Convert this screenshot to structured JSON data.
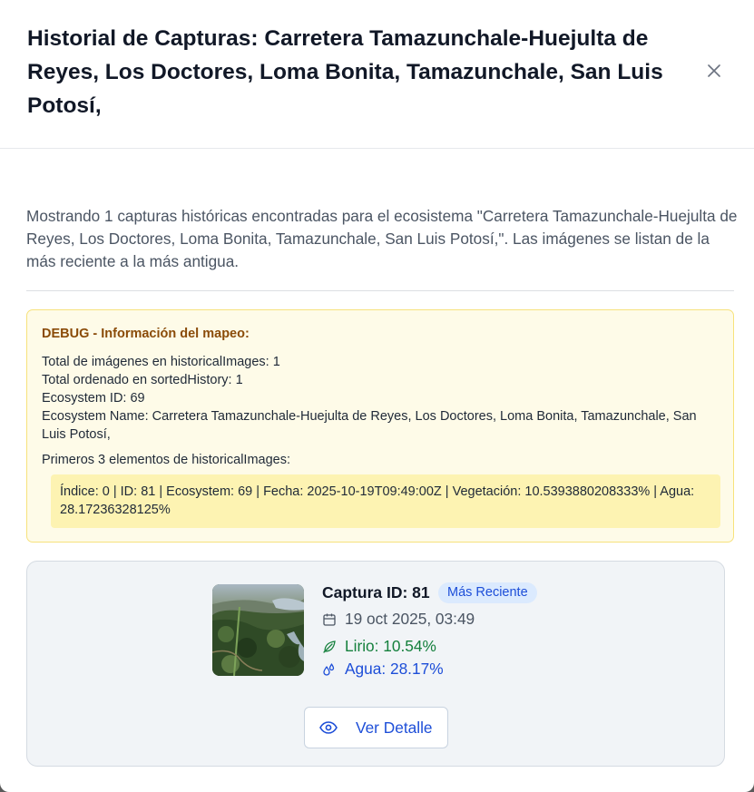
{
  "modal": {
    "title": "Historial de Capturas: Carretera Tamazunchale-Huejulta de Reyes, Los Doctores, Loma Bonita, Tamazunchale, San Luis Potosí,",
    "close_icon": "close-icon"
  },
  "description": "Mostrando 1 capturas históricas encontradas para el ecosistema \"Carretera Tamazunchale-Huejulta de Reyes, Los Doctores, Loma Bonita, Tamazunchale, San Luis Potosí,\". Las imágenes se listan de la más reciente a la más antigua.",
  "debug": {
    "title": "DEBUG - Información del mapeo:",
    "lines": [
      "Total de imágenes en historicalImages: 1",
      "Total ordenado en sortedHistory: 1",
      "Ecosystem ID: 69",
      "Ecosystem Name: Carretera Tamazunchale-Huejulta de Reyes, Los Doctores, Loma Bonita, Tamazunchale, San Luis Potosí,"
    ],
    "subtitle": "Primeros 3 elementos de historicalImages:",
    "items": [
      "Índice: 0 | ID: 81 | Ecosystem: 69 | Fecha: 2025-10-19T09:49:00Z | Vegetación: 10.5393880208333% | Agua: 28.17236328125%"
    ]
  },
  "capture": {
    "title": "Captura ID: 81",
    "badge": "Más Reciente",
    "date": "19 oct 2025, 03:49",
    "lirio": "Lirio: 10.54%",
    "agua": "Agua: 28.17%",
    "button_label": "Ver Detalle",
    "icons": [
      "calendar-icon",
      "leaf-icon",
      "droplets-icon",
      "eye-icon"
    ]
  },
  "colors": {
    "accent": "#1d4ed8",
    "lirio": "#15803d",
    "debug_bg": "#fefbe8",
    "debug_title": "#8a4b08"
  }
}
